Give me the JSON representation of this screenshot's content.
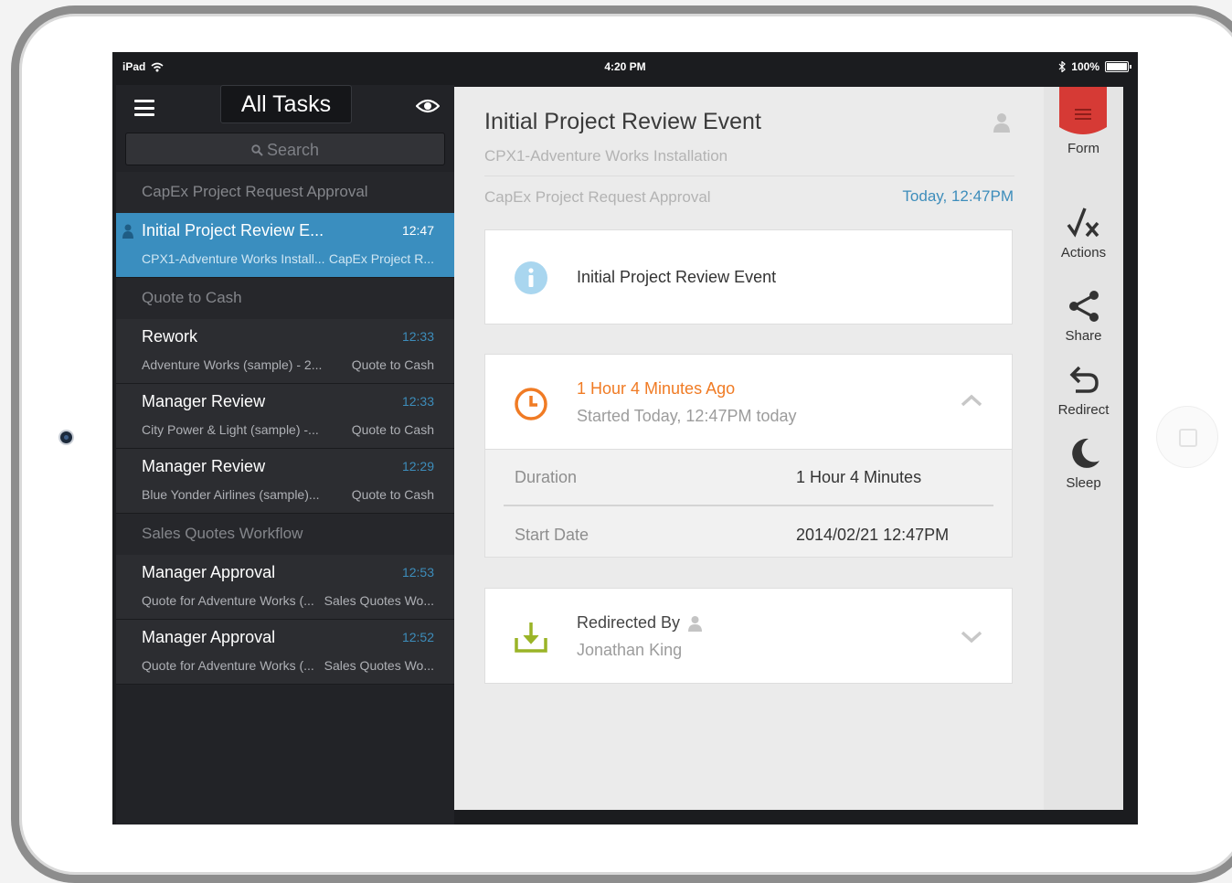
{
  "status": {
    "carrier": "iPad",
    "time": "4:20 PM",
    "battery": "100%"
  },
  "sidebar": {
    "title": "All Tasks",
    "search_placeholder": "Search",
    "groups": [
      {
        "header": "CapEx Project Request Approval",
        "items": [
          {
            "title": "Initial Project Review E...",
            "time": "12:47",
            "sub1": "CPX1-Adventure Works Install...",
            "sub2": "CapEx Project R...",
            "active": true
          }
        ]
      },
      {
        "header": "Quote to Cash",
        "items": [
          {
            "title": "Rework",
            "time": "12:33",
            "sub1": "Adventure Works (sample) - 2...",
            "sub2": "Quote to Cash"
          },
          {
            "title": "Manager Review",
            "time": "12:33",
            "sub1": "City Power & Light (sample) -...",
            "sub2": "Quote to Cash"
          },
          {
            "title": "Manager Review",
            "time": "12:29",
            "sub1": "Blue Yonder Airlines (sample)...",
            "sub2": "Quote to Cash"
          }
        ]
      },
      {
        "header": "Sales Quotes Workflow",
        "items": [
          {
            "title": "Manager Approval",
            "time": "12:53",
            "sub1": "Quote for Adventure Works (...",
            "sub2": "Sales Quotes Wo..."
          },
          {
            "title": "Manager Approval",
            "time": "12:52",
            "sub1": "Quote for Adventure Works (...",
            "sub2": "Sales Quotes Wo..."
          }
        ]
      }
    ]
  },
  "detail": {
    "title": "Initial Project Review Event",
    "subtitle": "CPX1-Adventure Works Installation",
    "category": "CapEx Project Request Approval",
    "date": "Today, 12:47PM",
    "info_text": "Initial Project Review Event",
    "elapsed": "1 Hour 4 Minutes Ago",
    "started": "Started Today, 12:47PM today",
    "duration_label": "Duration",
    "duration_value": "1 Hour 4 Minutes",
    "start_label": "Start Date",
    "start_value": "2014/02/21 12:47PM",
    "redirected_label": "Redirected By",
    "redirected_name": "Jonathan King"
  },
  "actions": {
    "form": "Form",
    "actions": "Actions",
    "share": "Share",
    "redirect": "Redirect",
    "sleep": "Sleep"
  },
  "colors": {
    "accent_blue": "#3a8ebf",
    "orange": "#f07b24",
    "ribbon_red": "#d63a35",
    "download_green": "#9ab427"
  }
}
